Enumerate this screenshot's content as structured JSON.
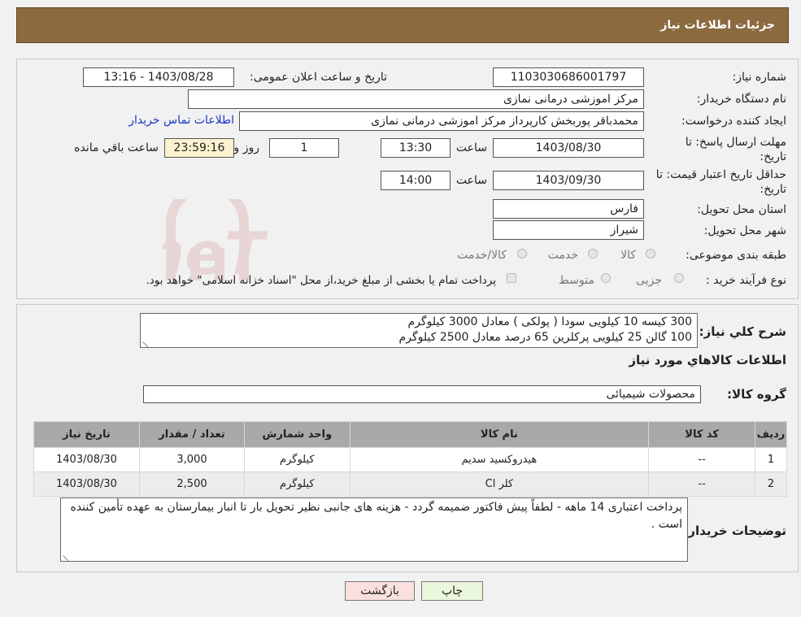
{
  "header": {
    "title": "جزئیات اطلاعات نیاز"
  },
  "form": {
    "need_number_label": "شماره نیاز:",
    "need_number": "1103030686001797",
    "announce_label": "تاریخ و ساعت اعلان عمومی:",
    "announce_value": "1403/08/28 - 13:16",
    "buyer_org_label": "نام دستگاه خریدار:",
    "buyer_org": "مرکز اموزشی درمانی نمازی",
    "creator_label": "ایجاد کننده درخواست:",
    "creator": "محمدباقر پوربخش کارپرداز مرکز اموزشی درمانی نمازی",
    "contact_link": "اطلاعات تماس خریدار",
    "deadline_label_1": "مهلت ارسال پاسخ: تا",
    "deadline_label_2": "تاریخ:",
    "deadline_date": "1403/08/30",
    "time_word": "ساعت",
    "deadline_time": "13:30",
    "days_value": "1",
    "days_word": "روز و",
    "remaining_time": "23:59:16",
    "remaining_word": "ساعت باقي مانده",
    "validity_label_1": "حداقل تاریخ اعتبار قیمت: تا",
    "validity_label_2": "تاریخ:",
    "validity_date": "1403/09/30",
    "validity_time": "14:00",
    "province_label": "استان محل تحویل:",
    "province": "فارس",
    "city_label": "شهر محل تحویل:",
    "city": "شیراز",
    "category_label": "طبقه بندی موضوعی:",
    "category_options": [
      "کالا",
      "خدمت",
      "کالا/خدمت"
    ],
    "process_label": "نوع فرآیند خرید :",
    "process_options": [
      "جزیی",
      "متوسط"
    ],
    "process_note": "پرداخت تمام یا بخشی از مبلغ خرید،از محل \"اسناد خزانه اسلامی\" خواهد بود."
  },
  "description": {
    "label": "شرح کلي نياز:",
    "lines": [
      "300 کیسه 10 کیلویی سودا ( پولکی ) معادل 3000 کیلوگرم",
      "100 گالن 25 کیلویی پرکلرین 65 درصد معادل 2500 کیلوگرم"
    ]
  },
  "goods": {
    "section_title": "اطلاعات کالاهاي مورد نياز",
    "group_label": "گروه کالا:",
    "group_value": "محصولات شیمیائی",
    "columns": [
      "رديف",
      "کد کالا",
      "نام کالا",
      "واحد شمارش",
      "تعداد / مقدار",
      "تاريخ نياز"
    ],
    "rows": [
      [
        "1",
        "--",
        "هیدروکسید سدیم",
        "کیلوگرم",
        "3,000",
        "1403/08/30"
      ],
      [
        "2",
        "--",
        "کلر Cl",
        "کیلوگرم",
        "2,500",
        "1403/08/30"
      ]
    ]
  },
  "notes": {
    "label": "توضیحات خریدار:",
    "text": "پرداخت اعتباری 14 ماهه - لطفاً پیش فاکتور ضمیمه گردد - هزینه های جانبی نظیر تحویل بار تا انبار بیمارستان به عهده تأمین کننده است ."
  },
  "buttons": {
    "print": "چاپ",
    "back": "بازگشت"
  },
  "watermark": {
    "text": "AriaTender.neT",
    "color": "#b22222"
  }
}
